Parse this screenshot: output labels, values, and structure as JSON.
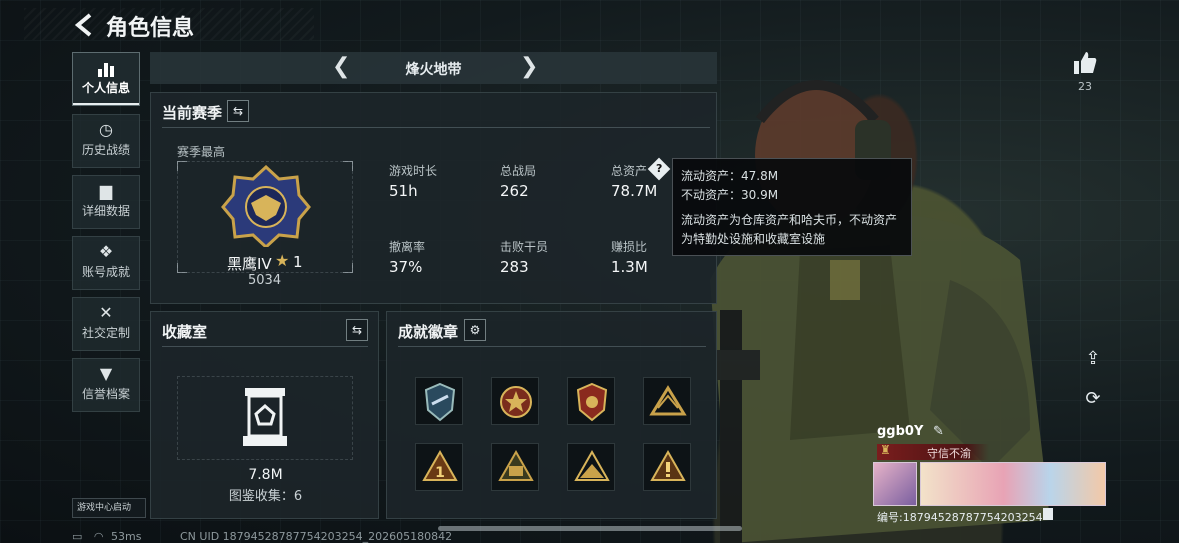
{
  "header": {
    "title": "角色信息"
  },
  "nav": [
    {
      "label": "个人信息",
      "icon": "bar-chart-icon",
      "active": true
    },
    {
      "label": "历史战绩",
      "icon": "clock-icon"
    },
    {
      "label": "详细数据",
      "icon": "folder-icon"
    },
    {
      "label": "账号成就",
      "icon": "medal-icon"
    },
    {
      "label": "社交定制",
      "icon": "tools-icon"
    },
    {
      "label": "信誉档案",
      "icon": "shield-icon"
    }
  ],
  "game_center": "游戏中心启动",
  "season_selector": {
    "name": "烽火地带"
  },
  "current_season": {
    "title": "当前赛季",
    "best_label": "赛季最高",
    "rank_name": "黑鹰IV",
    "rank_stars": "1",
    "rank_points": "5034",
    "stats": [
      {
        "label": "游戏时长",
        "value": "51h"
      },
      {
        "label": "总战局",
        "value": "262"
      },
      {
        "label": "总资产",
        "value": "78.7M"
      },
      {
        "label": "撤离率",
        "value": "37%"
      },
      {
        "label": "击败干员",
        "value": "283"
      },
      {
        "label": "赚损比",
        "value": "1.3M"
      }
    ]
  },
  "tooltip": {
    "line1": "流动资产：47.8M",
    "line2": "不动资产：30.9M",
    "line3": "流动资产为仓库资产和哈夫币，不动资产",
    "line4": "为特勤处设施和收藏室设施"
  },
  "collection": {
    "title": "收藏室",
    "value": "7.8M",
    "count_label": "图鉴收集：6"
  },
  "achievements": {
    "title": "成就徽章"
  },
  "player": {
    "likes": "23",
    "name": "ggb0Y",
    "title": "守信不渝",
    "id_line": "编号:187945287877542032​54"
  },
  "status": {
    "ping": "53ms",
    "uid": "CN UID 187945287877542032​54_202605180842"
  },
  "colors": {
    "accent_red": "#7a1d1d",
    "panel_bg": "#1c2529",
    "gold": "#c9a24a"
  }
}
